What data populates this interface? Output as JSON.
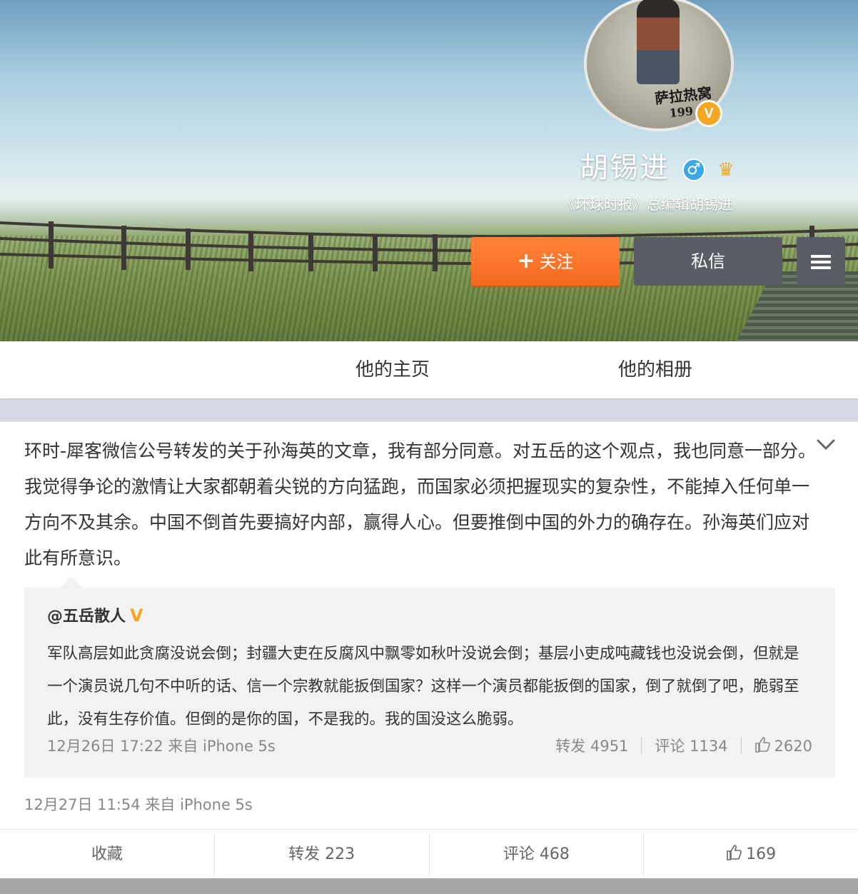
{
  "profile": {
    "name": "胡锡进",
    "description": "《环球时报》总编辑胡锡进",
    "avatar_stamp": "萨拉热窝",
    "avatar_year": "199",
    "verified_mark": "V",
    "gender_symbol": "♂"
  },
  "buttons": {
    "follow_plus": "+",
    "follow_label": "关注",
    "message_label": "私信"
  },
  "tabs": [
    {
      "label": "他的主页"
    },
    {
      "label": "他的相册"
    }
  ],
  "post": {
    "text": "环时-犀客微信公号转发的关于孙海英的文章，我有部分同意。对五岳的这个观点，我也同意一部分。我觉得争论的激情让大家都朝着尖锐的方向猛跑，而国家必须把握现实的复杂性，不能掉入任何单一方向不及其余。中国不倒首先要搞好内部，赢得人心。但要推倒中国的外力的确存在。孙海英们应对此有所意识。",
    "meta": "12月27日 11:54 来自 iPhone 5s",
    "repost": {
      "author": "@五岳散人",
      "author_badge": "V",
      "text": "军队高层如此贪腐没说会倒；封疆大吏在反腐风中飘零如秋叶没说会倒；基层小吏成吨藏钱也没说会倒，但就是一个演员说几句不中听的话、信一个宗教就能扳倒国家？这样一个演员都能扳倒的国家，倒了就倒了吧，脆弱至此，没有生存价值。但倒的是你的国，不是我的。我的国没这么脆弱。",
      "meta": "12月26日 17:22 来自 iPhone 5s",
      "repost_label": "转发 4951",
      "comment_label": "评论 1134",
      "like_count": "2620"
    },
    "actions": {
      "favorite": "收藏",
      "repost": "转发 223",
      "comment": "评论 468",
      "like_count": "169"
    }
  },
  "colors": {
    "follow_button": "#f56a1f",
    "dark_button": "#5b5d66",
    "verified": "#f6a623",
    "gender": "#3aa7e6"
  },
  "icons": [
    "plus-icon",
    "menu-icon",
    "chevron-down-icon",
    "verified-icon",
    "male-icon",
    "member-icon",
    "thumbs-up-icon"
  ]
}
